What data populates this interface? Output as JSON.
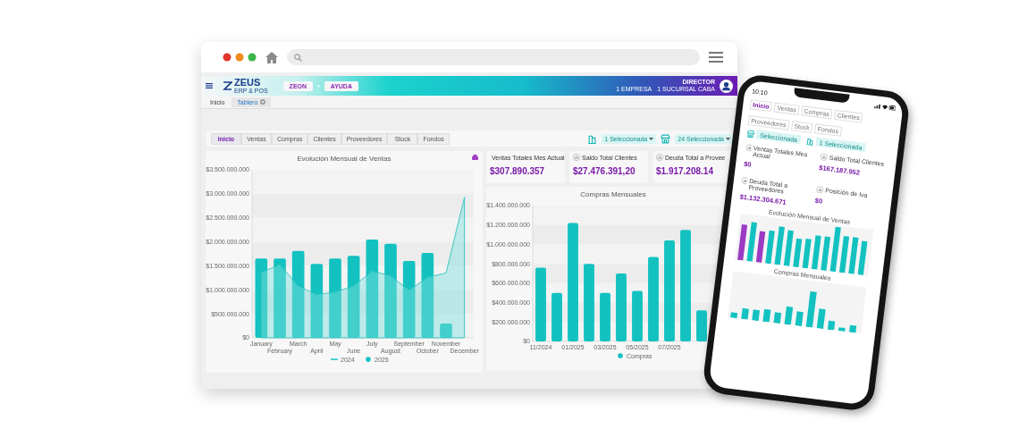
{
  "app_header": {
    "logo": {
      "name": "ZEUS",
      "tagline": "ERP & POS"
    },
    "buttons": [
      "ZEON",
      "AYUDA"
    ],
    "separator": "+",
    "role": "DIRECTOR",
    "company": "1 EMPRESA",
    "branch": "1 SUCURSAL CABA"
  },
  "breadcrumbs": [
    {
      "label": "Inicio",
      "selected": false
    },
    {
      "label": "Tablero",
      "selected": true
    }
  ],
  "tabs": [
    {
      "label": "Inicio",
      "selected": true
    },
    {
      "label": "Ventas",
      "selected": false
    },
    {
      "label": "Compras",
      "selected": false
    },
    {
      "label": "Clientes",
      "selected": false
    },
    {
      "label": "Proveedores",
      "selected": false
    },
    {
      "label": "Stock",
      "selected": false
    },
    {
      "label": "Fondos",
      "selected": false
    }
  ],
  "filters": [
    {
      "kind": "building",
      "value": "1 Seleccionada"
    },
    {
      "kind": "store",
      "value": "24 Seleccionada"
    }
  ],
  "sales_chart": {
    "chart_data": {
      "type": "bar",
      "title": "Evolución Mensual de Ventas",
      "categories": [
        "January",
        "February",
        "March",
        "April",
        "May",
        "June",
        "July",
        "August",
        "September",
        "October",
        "November",
        "December"
      ],
      "series": [
        {
          "name": "2024",
          "type": "area",
          "color": "#7fe0dc",
          "values": [
            1360000000,
            1530000000,
            1080000000,
            900000000,
            950000000,
            1080000000,
            1390000000,
            1290000000,
            990000000,
            1260000000,
            1350000000,
            2930000000
          ]
        },
        {
          "name": "2025",
          "type": "bar",
          "color": "#13c2c0",
          "values": [
            1650000000,
            1650000000,
            1810000000,
            1540000000,
            1650000000,
            1710000000,
            2050000000,
            1960000000,
            1600000000,
            1770000000,
            300000000,
            null
          ]
        }
      ],
      "ylim": [
        0,
        3500000000
      ],
      "yticks": [
        {
          "value": 0,
          "label": "$0"
        },
        {
          "value": 500000000,
          "label": "$500.000.000"
        },
        {
          "value": 1000000000,
          "label": "$1.000.000.000"
        },
        {
          "value": 1500000000,
          "label": "$1.500.000.000"
        },
        {
          "value": 2000000000,
          "label": "$2.000.000.000"
        },
        {
          "value": 2500000000,
          "label": "$2.500.000.000"
        },
        {
          "value": 3000000000,
          "label": "$3.000.000.000"
        },
        {
          "value": 3500000000,
          "label": "$3.500.000.000"
        }
      ]
    }
  },
  "kpis": [
    {
      "label": "Ventas Totales Mes Actual",
      "value": "$307.890.357"
    },
    {
      "label": "Saldo Total Clientes",
      "value": "$27.476.391,20"
    },
    {
      "label": "Deuda Total a Provee",
      "value": "$1.917.208.14"
    }
  ],
  "purchases_chart": {
    "chart_data": {
      "type": "bar",
      "title": "Compras Mensuales",
      "categories": [
        "11/2024",
        null,
        "01/2025",
        null,
        "03/2025",
        null,
        "05/2025",
        null,
        "07/2025",
        null,
        null
      ],
      "series": [
        {
          "name": "Compras",
          "color": "#13c2c0",
          "values": [
            760000000,
            500000000,
            1220000000,
            800000000,
            500000000,
            700000000,
            520000000,
            870000000,
            1040000000,
            1150000000,
            320000000
          ]
        }
      ],
      "ylim": [
        0,
        1400000000
      ],
      "yticks": [
        {
          "value": 0,
          "label": "$0"
        },
        {
          "value": 200000000,
          "label": "$200.000.000"
        },
        {
          "value": 400000000,
          "label": "$400.000.000"
        },
        {
          "value": 600000000,
          "label": "$600.000.000"
        },
        {
          "value": 800000000,
          "label": "$800.000.000"
        },
        {
          "value": 1000000000,
          "label": "$1.000.000.000"
        },
        {
          "value": 1200000000,
          "label": "$1.200.000.000"
        },
        {
          "value": 1400000000,
          "label": "$1.400.000.000"
        }
      ]
    }
  },
  "phone": {
    "time": "10:10",
    "tabs": [
      {
        "label": "Inicio",
        "selected": true
      },
      {
        "label": "Ventas",
        "selected": false
      },
      {
        "label": "Compras",
        "selected": false
      },
      {
        "label": "Clientes",
        "selected": false
      },
      {
        "label": "Proveedores",
        "selected": false
      },
      {
        "label": "Stock",
        "selected": false
      },
      {
        "label": "Fondos",
        "selected": false
      }
    ],
    "filters": [
      {
        "kind": "store",
        "value": "Seleccionada"
      },
      {
        "kind": "building",
        "value": "1 Seleccionada"
      }
    ],
    "kpis": [
      {
        "label": "Ventas Totales Mes Actual",
        "value": "$0"
      },
      {
        "label": "Saldo Total Clientes",
        "value": "$167.187.952"
      },
      {
        "label": "Deuda Total a Proveedores",
        "value": "$1.132.304.671"
      },
      {
        "label": "Posición de Iva",
        "value": "$0"
      }
    ],
    "charts": [
      {
        "title": "Evolución Mensual de Ventas"
      },
      {
        "title": "Compras Mensuales"
      }
    ]
  }
}
